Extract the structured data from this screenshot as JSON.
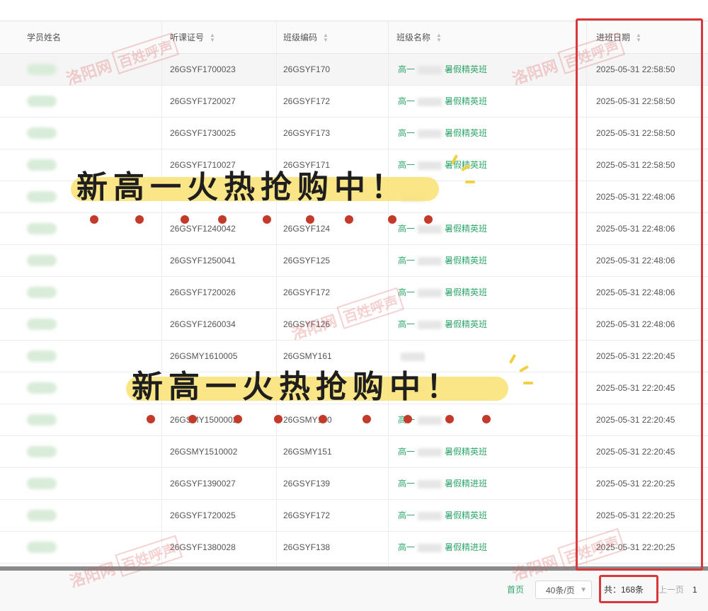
{
  "columns": {
    "name": "学员姓名",
    "cert": "听课证号",
    "code": "班级编码",
    "cname": "班级名称",
    "date": "进班日期"
  },
  "rows": [
    {
      "cert": "26GSYF1700023",
      "code": "26GSYF170",
      "cname_pre": "高一",
      "cname_suf": "暑假精英班",
      "date": "2025-05-31 22:58:50"
    },
    {
      "cert": "26GSYF1720027",
      "code": "26GSYF172",
      "cname_pre": "高一",
      "cname_suf": "暑假精英班",
      "date": "2025-05-31 22:58:50"
    },
    {
      "cert": "26GSYF1730025",
      "code": "26GSYF173",
      "cname_pre": "高一",
      "cname_suf": "暑假精英班",
      "date": "2025-05-31 22:58:50"
    },
    {
      "cert": "26GSYF1710027",
      "code": "26GSYF171",
      "cname_pre": "高一",
      "cname_suf": "暑假精英班",
      "date": "2025-05-31 22:58:50"
    },
    {
      "cert": "",
      "code": "",
      "cname_pre": "",
      "cname_suf": "",
      "date": "2025-05-31 22:48:06"
    },
    {
      "cert": "26GSYF1240042",
      "code": "26GSYF124",
      "cname_pre": "高一",
      "cname_suf": "暑假精英班",
      "date": "2025-05-31 22:48:06"
    },
    {
      "cert": "26GSYF1250041",
      "code": "26GSYF125",
      "cname_pre": "高一",
      "cname_suf": "暑假精英班",
      "date": "2025-05-31 22:48:06"
    },
    {
      "cert": "26GSYF1720026",
      "code": "26GSYF172",
      "cname_pre": "高一",
      "cname_suf": "暑假精英班",
      "date": "2025-05-31 22:48:06"
    },
    {
      "cert": "26GSYF1260034",
      "code": "26GSYF126",
      "cname_pre": "高一",
      "cname_suf": "暑假精英班",
      "date": "2025-05-31 22:48:06"
    },
    {
      "cert": "26GSMY1610005",
      "code": "26GSMY161",
      "cname_pre": "",
      "cname_suf": "",
      "date": "2025-05-31 22:20:45"
    },
    {
      "cert": "",
      "code": "",
      "cname_pre": "",
      "cname_suf": "",
      "date": "2025-05-31 22:20:45"
    },
    {
      "cert": "26GSMY1500002",
      "code": "26GSMY150",
      "cname_pre": "高一",
      "cname_suf": "",
      "date": "2025-05-31 22:20:45"
    },
    {
      "cert": "26GSMY1510002",
      "code": "26GSMY151",
      "cname_pre": "高一",
      "cname_suf": "暑假精英班",
      "date": "2025-05-31 22:20:45"
    },
    {
      "cert": "26GSYF1390027",
      "code": "26GSYF139",
      "cname_pre": "高一",
      "cname_suf": "暑假精进班",
      "date": "2025-05-31 22:20:25"
    },
    {
      "cert": "26GSYF1720025",
      "code": "26GSYF172",
      "cname_pre": "高一",
      "cname_suf": "暑假精英班",
      "date": "2025-05-31 22:20:25"
    },
    {
      "cert": "26GSYF1380028",
      "code": "26GSYF138",
      "cname_pre": "高一",
      "cname_suf": "暑假精进班",
      "date": "2025-05-31 22:20:25"
    }
  ],
  "pagination": {
    "first": "首页",
    "page_size": "40条/页",
    "total": "共：168条",
    "prev": "上一页",
    "page": "1"
  },
  "overlay": {
    "banner1": "新高一火热抢购中！",
    "banner2": "新高一火热抢购中！",
    "watermark_a": "洛阳网",
    "watermark_b": "百姓呼声"
  },
  "colors": {
    "highlight_box": "#d9383a",
    "link_green": "#2fa56b",
    "banner_yellow": "#fbe37a"
  }
}
